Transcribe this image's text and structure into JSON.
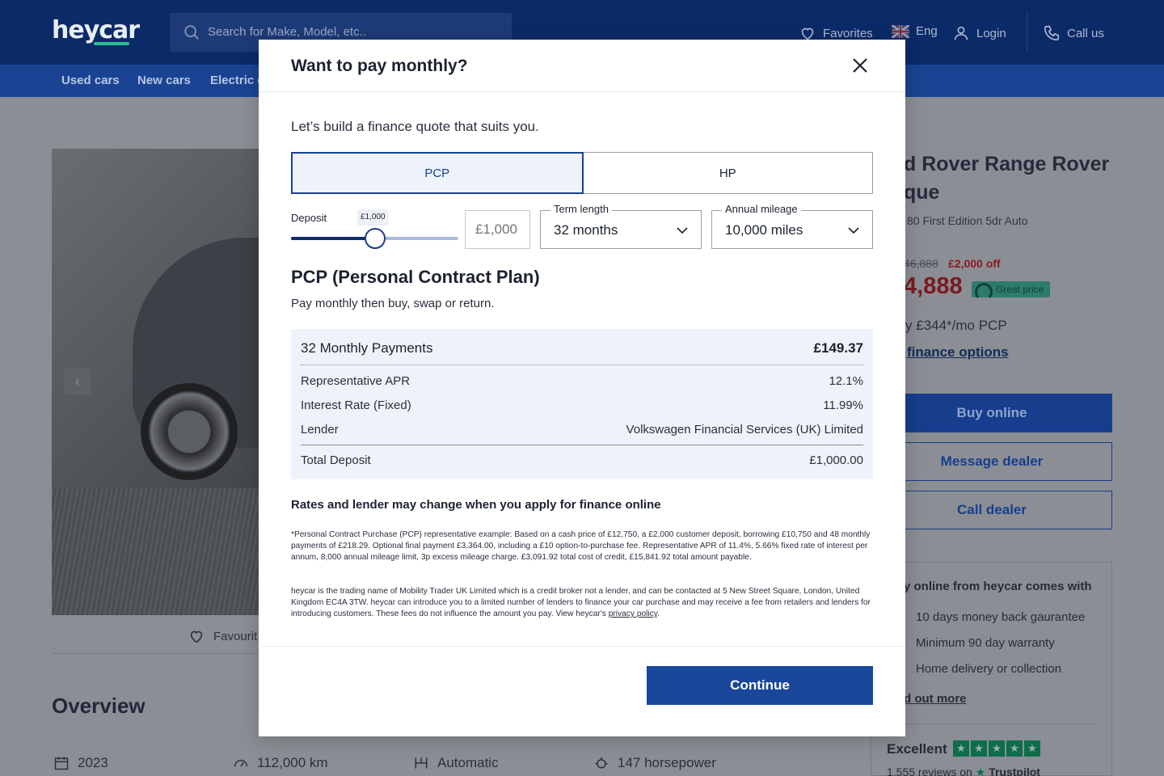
{
  "header": {
    "logo": "heycar",
    "search_placeholder": "Search for Make, Model, etc..",
    "favorites": "Favorites",
    "language": "Eng",
    "login": "Login",
    "call_us": "Call us"
  },
  "nav": {
    "items": [
      "Used cars",
      "New cars",
      "Electric c"
    ]
  },
  "listing": {
    "title": "d Rover Range Rover que",
    "title_line1": "d Rover Range Rover",
    "title_line2": "que",
    "subtitle": "80 First Edition 5dr Auto",
    "old_price": "46,888",
    "discount": "£2,000 off",
    "price": "4,888",
    "price_badge": "Great price",
    "monthly": "y £344*/mo PCP",
    "finance_link": "finance options",
    "buy_online": "Buy online",
    "message_dealer": "Message dealer",
    "call_dealer": "Call dealer",
    "perks_title": "y online from heycar comes with",
    "perks": [
      "10 days money back gaurantee",
      "Minimum 90 day warranty",
      "Home delivery or collection"
    ],
    "find_out_more": "d out more",
    "trust_label": "Excellent",
    "reviews": "1,555 reviews on",
    "trustpilot": "Trustpilot",
    "favourite": "Favourit",
    "overview_title": "Overview",
    "specs": {
      "year": "2023",
      "mileage": "112,000 km",
      "transmission": "Automatic",
      "power": "147 horsepower"
    }
  },
  "modal": {
    "title": "Want to pay monthly?",
    "intro": "Let’s build a finance quote that suits you.",
    "tabs": [
      {
        "label": "PCP",
        "active": true
      },
      {
        "label": "HP",
        "active": false
      }
    ],
    "deposit": {
      "label": "Deposit",
      "bubble": "£1,000",
      "input_placeholder": "£1,000",
      "slider_fraction": 0.5
    },
    "term": {
      "label": "Term length",
      "value": "32 months"
    },
    "mileage": {
      "label": "Annual mileage",
      "value": "10,000 miles"
    },
    "plan_title": "PCP (Personal Contract Plan)",
    "plan_desc": "Pay monthly then buy, swap or return.",
    "quote": {
      "monthly_label": "32 Monthly Payments",
      "monthly_value": "£149.37",
      "apr_label": "Representative APR",
      "apr_value": "12.1%",
      "interest_label": "Interest Rate (Fixed)",
      "interest_value": "11.99%",
      "lender_label": "Lender",
      "lender_value": "Volkswagen Financial Services (UK) Limited",
      "deposit_label": "Total Deposit",
      "deposit_value": "£1,000.00"
    },
    "rates_note": "Rates and lender may change when you apply for finance online",
    "fine_print_1": "*Personal Contract Purchase (PCP) representative example: Based on a cash price of £12,750, a £2,000 customer deposit, borrowing £10,750 and 48 monthly payments of £218.29. Optional final payment £3,364.00, including a £10 option-to-purchase fee. Representative APR of 11.4%, 5.66% fixed rate of interest per annum, 8,000 annual mileage limit, 3p excess mileage charge. £3,091.92 total cost of credit, £15,841.92 total amount payable.",
    "fine_print_2": "heycar is the trading name of Mobility Trader UK Limited which is a credit broker not a lender, and can be contacted at 5 New Street Square, London, United Kingdom EC4A 3TW. heycar can introduce you to a limited number of lenders to finance your car purchase and may receive a fee from retailers and lenders for introducing customers. These fees do not influence the amount you pay. View heycar's",
    "privacy_link": "privacy policy",
    "continue": "Continue"
  }
}
